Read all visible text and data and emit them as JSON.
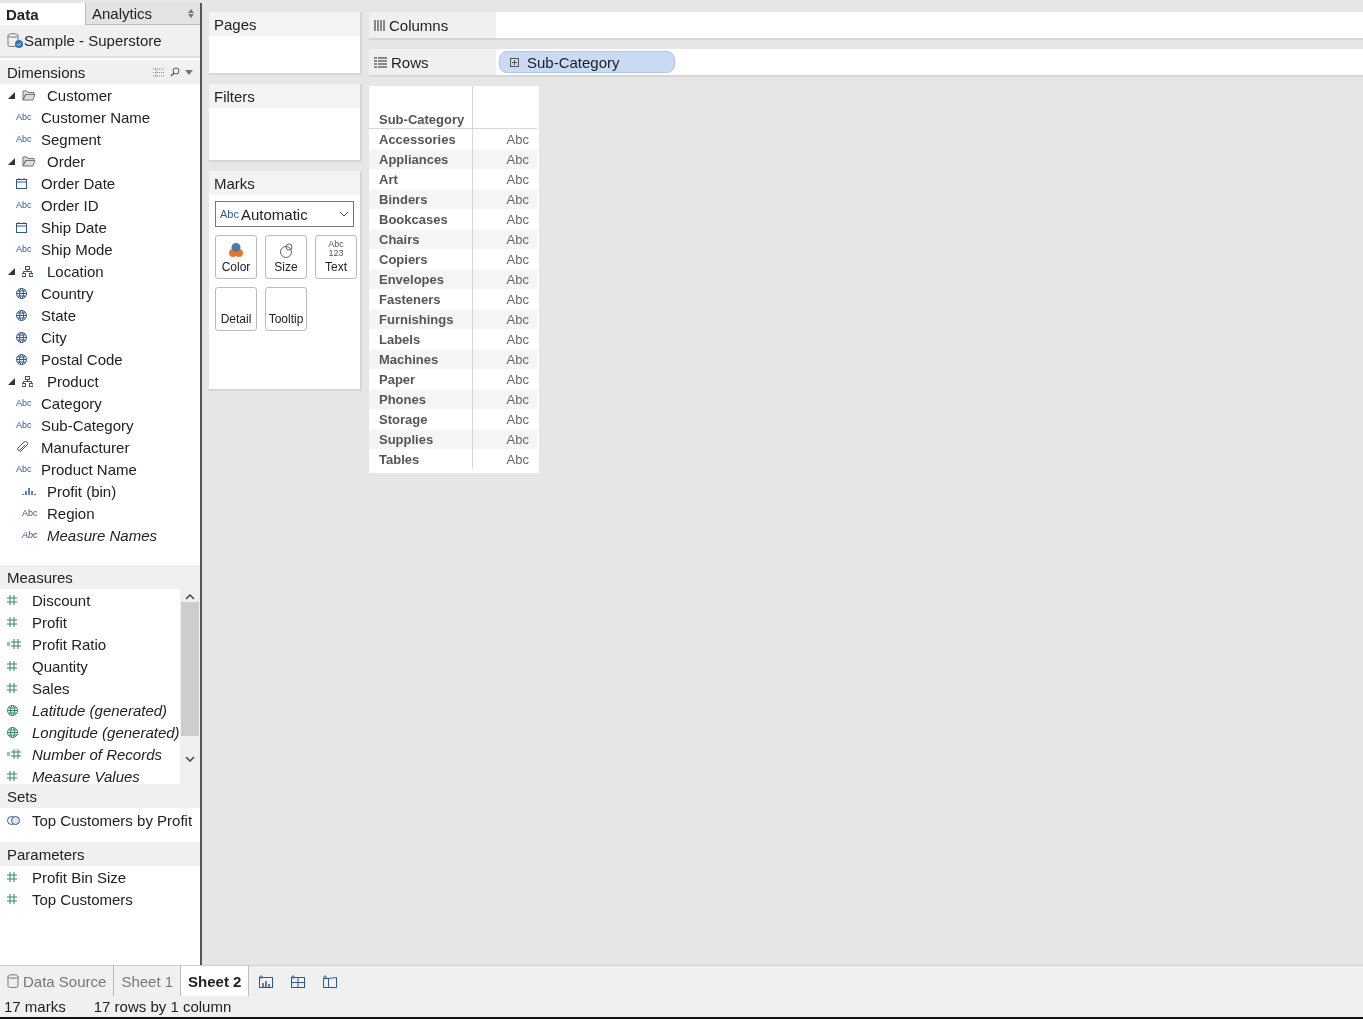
{
  "sidebar_tabs": [
    {
      "label": "Data",
      "selected": true
    },
    {
      "label": "Analytics",
      "selected": false
    }
  ],
  "datasource": "Sample - Superstore",
  "dimensions": {
    "title": "Dimensions",
    "items": [
      {
        "label": "Customer",
        "kind": "folder",
        "expanded": true,
        "children": [
          {
            "label": "Customer Name",
            "kind": "abc",
            "icon_text": "Abc"
          },
          {
            "label": "Segment",
            "kind": "abc",
            "icon_text": "Abc"
          }
        ]
      },
      {
        "label": "Order",
        "kind": "folder",
        "expanded": true,
        "children": [
          {
            "label": "Order Date",
            "kind": "date"
          },
          {
            "label": "Order ID",
            "kind": "abc",
            "icon_text": "Abc"
          },
          {
            "label": "Ship Date",
            "kind": "date"
          },
          {
            "label": "Ship Mode",
            "kind": "abc",
            "icon_text": "Abc"
          }
        ]
      },
      {
        "label": "Location",
        "kind": "hierarchy",
        "expanded": true,
        "children": [
          {
            "label": "Country",
            "kind": "geo"
          },
          {
            "label": "State",
            "kind": "geo"
          },
          {
            "label": "City",
            "kind": "geo"
          },
          {
            "label": "Postal Code",
            "kind": "geo"
          }
        ]
      },
      {
        "label": "Product",
        "kind": "hierarchy",
        "expanded": true,
        "children": [
          {
            "label": "Category",
            "kind": "abc",
            "icon_text": "Abc"
          },
          {
            "label": "Sub-Category",
            "kind": "abc",
            "icon_text": "Abc"
          },
          {
            "label": "Manufacturer",
            "kind": "group"
          },
          {
            "label": "Product Name",
            "kind": "abc",
            "icon_text": "Abc"
          }
        ]
      },
      {
        "label": "Profit (bin)",
        "kind": "bin"
      },
      {
        "label": "Region",
        "kind": "abc",
        "icon_text": "Abc"
      },
      {
        "label": "Measure Names",
        "kind": "abc",
        "icon_text": "Abc",
        "italic": true
      }
    ]
  },
  "measures": {
    "title": "Measures",
    "items": [
      {
        "label": "Discount",
        "kind": "number",
        "italic": false
      },
      {
        "label": "Profit",
        "kind": "number",
        "italic": false
      },
      {
        "label": "Profit Ratio",
        "kind": "calc",
        "italic": false
      },
      {
        "label": "Quantity",
        "kind": "number",
        "italic": false
      },
      {
        "label": "Sales",
        "kind": "number",
        "italic": false
      },
      {
        "label": "Latitude (generated)",
        "kind": "geo",
        "italic": true
      },
      {
        "label": "Longitude (generated)",
        "kind": "geo",
        "italic": true
      },
      {
        "label": "Number of Records",
        "kind": "calc",
        "italic": true
      },
      {
        "label": "Measure Values",
        "kind": "number",
        "italic": true
      }
    ]
  },
  "sets": {
    "title": "Sets",
    "items": [
      {
        "label": "Top Customers by Profit",
        "kind": "set"
      }
    ]
  },
  "parameters": {
    "title": "Parameters",
    "items": [
      {
        "label": "Profit Bin Size",
        "kind": "number"
      },
      {
        "label": "Top Customers",
        "kind": "number"
      }
    ]
  },
  "pages": {
    "title": "Pages"
  },
  "filters": {
    "title": "Filters"
  },
  "marks": {
    "title": "Marks",
    "type_icon": "Abc",
    "type": "Automatic",
    "cards": [
      {
        "label": "Color",
        "kind": "color"
      },
      {
        "label": "Size",
        "kind": "size"
      },
      {
        "label": "Text",
        "kind": "text",
        "icon_lines": [
          "Abc",
          "123"
        ]
      },
      {
        "label": "Detail",
        "kind": "plain"
      },
      {
        "label": "Tooltip",
        "kind": "plain"
      }
    ]
  },
  "columns_shelf": {
    "label": "Columns"
  },
  "rows_shelf": {
    "label": "Rows",
    "pills": [
      "Sub-Category"
    ]
  },
  "table": {
    "header": "Sub-Category",
    "rows": [
      {
        "label": "Accessories",
        "value": "Abc"
      },
      {
        "label": "Appliances",
        "value": "Abc"
      },
      {
        "label": "Art",
        "value": "Abc"
      },
      {
        "label": "Binders",
        "value": "Abc"
      },
      {
        "label": "Bookcases",
        "value": "Abc"
      },
      {
        "label": "Chairs",
        "value": "Abc"
      },
      {
        "label": "Copiers",
        "value": "Abc"
      },
      {
        "label": "Envelopes",
        "value": "Abc"
      },
      {
        "label": "Fasteners",
        "value": "Abc"
      },
      {
        "label": "Furnishings",
        "value": "Abc"
      },
      {
        "label": "Labels",
        "value": "Abc"
      },
      {
        "label": "Machines",
        "value": "Abc"
      },
      {
        "label": "Paper",
        "value": "Abc"
      },
      {
        "label": "Phones",
        "value": "Abc"
      },
      {
        "label": "Storage",
        "value": "Abc"
      },
      {
        "label": "Supplies",
        "value": "Abc"
      },
      {
        "label": "Tables",
        "value": "Abc"
      }
    ]
  },
  "sheet_tabs": [
    {
      "label": "Data Source",
      "kind": "datasource",
      "selected": false
    },
    {
      "label": "Sheet 1",
      "kind": "sheet",
      "selected": false
    },
    {
      "label": "Sheet 2",
      "kind": "sheet",
      "selected": true
    }
  ],
  "status_bar": {
    "marks": "17 marks",
    "summary": "17 rows by 1 column"
  }
}
